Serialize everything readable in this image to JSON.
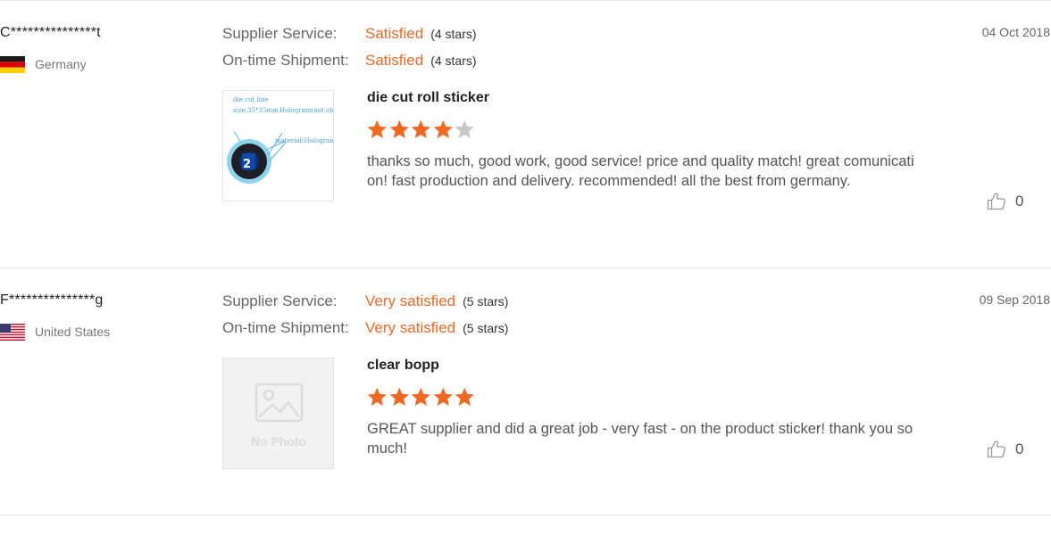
{
  "labels": {
    "supplier_service": "Supplier Service:",
    "ontime_shipment": "On-time Shipment:"
  },
  "colors": {
    "accent": "#f26722",
    "star_empty": "#c8c8c8"
  },
  "reviews": [
    {
      "user": "C***************t",
      "country": "Germany",
      "flag_icon": "germany-flag-icon",
      "date": "04 Oct 2018",
      "supplier_service": {
        "rating": "Satisfied",
        "stars": "(4 stars)"
      },
      "ontime_shipment": {
        "rating": "Satisfied",
        "stars": "(4 stars)"
      },
      "product": "die cut roll sticker",
      "star_rating": 4,
      "comment": "thanks so much, good work, good service! price and quality match! great comunication! fast production and delivery. recommended! all the best from germany.",
      "likes": "0",
      "thumbnail": {
        "type": "photo",
        "annotations": [
          "die cut line",
          "size:35*35mm",
          "Hologram(not obvious)",
          "material(Hologram)"
        ]
      }
    },
    {
      "user": "F***************g",
      "country": "United States",
      "flag_icon": "usa-flag-icon",
      "date": "09 Sep 2018",
      "supplier_service": {
        "rating": "Very satisfied",
        "stars": "(5 stars)"
      },
      "ontime_shipment": {
        "rating": "Very satisfied",
        "stars": "(5 stars)"
      },
      "product": "clear bopp",
      "star_rating": 5,
      "comment": "GREAT supplier and did a great job - very fast - on the product sticker!  thank you so much!",
      "likes": "0",
      "thumbnail": {
        "type": "placeholder",
        "text": "No Photo"
      }
    }
  ]
}
